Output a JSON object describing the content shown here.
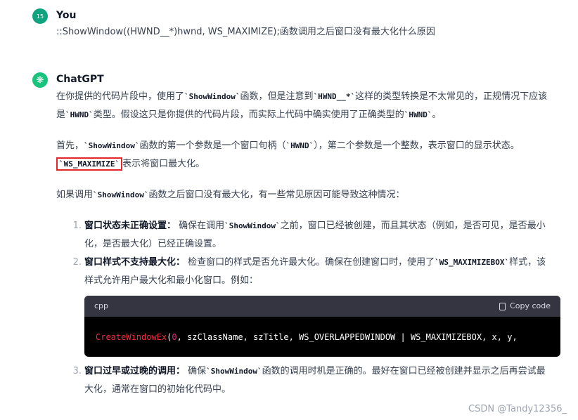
{
  "user_message": {
    "avatar_text": "15",
    "name": "You",
    "text": "::ShowWindow((HWND__*)hwnd, WS_MAXIMIZE);函数调用之后窗口没有最大化什么原因"
  },
  "assistant_message": {
    "name": "ChatGPT",
    "para1": {
      "t1": "在你提供的代码片段中，使用了",
      "c1": "`ShowWindow`",
      "t2": "函数，但是注意到",
      "c2": "`HWND__*`",
      "t3": "这样的类型转换是不太常见的，正规情况下应该是",
      "c3": "`HWND`",
      "t4": "类型。假设这只是你提供的代码片段，而实际上代码中确实使用了正确类型的",
      "c4": "`HWND`",
      "t5": "。"
    },
    "para2": {
      "t1": "首先，",
      "c1": "`ShowWindow`",
      "t2": "函数的第一个参数是一个窗口句柄（",
      "c2": "`HWND`",
      "t3": "），第二个参数是一个整数，表示窗口的显示状态。",
      "c3": "`WS_MAXIMIZE`",
      "t4": "表示将窗口最大化。"
    },
    "para3": {
      "t1": "如果调用",
      "c1": "`ShowWindow`",
      "t2": "函数之后窗口没有最大化，有一些常见原因可能导致这种情况："
    },
    "list": [
      {
        "num": "1.",
        "title": "窗口状态未正确设置：",
        "t1": "确保在调用",
        "c1": "`ShowWindow`",
        "t2": "之前，窗口已经被创建，而且其状态（例如，是否可见，是否最小化，是否最大化）已经正确设置。"
      },
      {
        "num": "2.",
        "title": "窗口样式不支持最大化：",
        "t1": "检查窗口的样式是否允许最大化。确保在创建窗口时，使用了",
        "c1": "`WS_MAXIMIZEBOX`",
        "t2": "样式，该样式允许用户最大化和最小化窗口。例如："
      },
      {
        "num": "3.",
        "title": "窗口过早或过晚的调用：",
        "t1": "确保",
        "c1": "`ShowWindow`",
        "t2": "函数的调用时机是正确的。最好在窗口已经被创建并显示之后再尝试最大化，通常在窗口的初始化代码中。"
      }
    ],
    "code_block": {
      "lang": "cpp",
      "copy_label": "Copy code",
      "fn": "CreateWindowEx",
      "open": "(",
      "zero": "0",
      "rest": ", szClassName, szTitle, WS_OVERLAPPEDWINDOW | WS_MAXIMIZEBOX, x, y,"
    }
  },
  "watermark": "CSDN @Tandy12356_"
}
